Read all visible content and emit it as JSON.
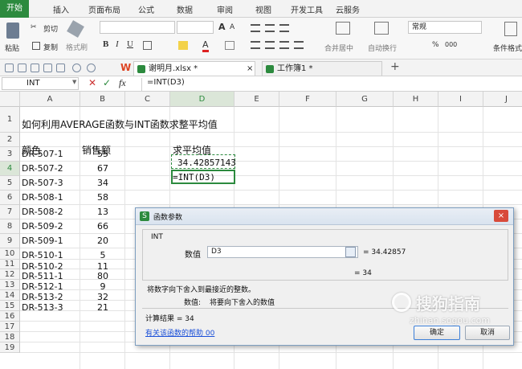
{
  "menu": {
    "items": [
      "开始",
      "插入",
      "页面布局",
      "公式",
      "数据",
      "审阅",
      "视图",
      "开发工具",
      "云服务"
    ]
  },
  "ribbon": {
    "paste": "粘贴",
    "cut": "剪切",
    "copy": "复制",
    "format_painter": "格式刷",
    "bold": "B",
    "italic": "I",
    "underline": "U",
    "font_grow": "A",
    "merge_center": "合并居中",
    "auto_wrap": "自动换行",
    "number_format": "常规",
    "percent": "%",
    "thousands": "000",
    "cond_format": "条件格式"
  },
  "tabs": [
    {
      "label": "谢明月.xlsx *"
    },
    {
      "label": "工作簿1 *"
    }
  ],
  "formula_bar": {
    "name_box": "INT",
    "fx": "fx",
    "formula": "=INT(D3)"
  },
  "columns": [
    "A",
    "B",
    "C",
    "D",
    "E",
    "F",
    "G",
    "H",
    "I",
    "J"
  ],
  "rows": [
    "1",
    "2",
    "3",
    "4",
    "5",
    "6",
    "7",
    "8",
    "9",
    "10",
    "11",
    "12",
    "13",
    "14",
    "15",
    "16",
    "17",
    "18",
    "19"
  ],
  "cells": {
    "a1": "如何利用AVERAGE函数与INT函数求整平均值",
    "a2": "颜色",
    "b2": "销售额",
    "d2": "求平均值",
    "d3": "34.42857143",
    "d4": "=INT(D3)",
    "data": [
      {
        "a": "DR-507-1",
        "b": "55"
      },
      {
        "a": "DR-507-2",
        "b": "67"
      },
      {
        "a": "DR-507-3",
        "b": "34"
      },
      {
        "a": "DR-508-1",
        "b": "58"
      },
      {
        "a": "DR-508-2",
        "b": "13"
      },
      {
        "a": "DR-509-2",
        "b": "66"
      },
      {
        "a": "DR-509-1",
        "b": "20"
      },
      {
        "a": "DR-510-1",
        "b": "5"
      },
      {
        "a": "DR-510-2",
        "b": "11"
      },
      {
        "a": "DR-511-1",
        "b": "80"
      },
      {
        "a": "DR-512-1",
        "b": "9"
      },
      {
        "a": "DR-513-2",
        "b": "32"
      },
      {
        "a": "DR-513-3",
        "b": "21"
      }
    ]
  },
  "dialog": {
    "title": "函数参数",
    "func_name": "INT",
    "arg_label": "数值",
    "arg_value": "D3",
    "arg_eval": "= 34.42857",
    "result_eval": "= 34",
    "description": "将数字向下舍入到最接近的整数。",
    "arg_desc_label": "数值:",
    "arg_desc": "将要向下舍入的数值",
    "calc_result": "计算结果 =  34",
    "help_link": "有关该函数的帮助 00",
    "ok": "确定",
    "cancel": "取消"
  },
  "watermark": {
    "text": "搜狗指南",
    "url": "zhinan.sogou.com"
  },
  "colors": {
    "accent": "#2c8a3e",
    "selection": "#2c8a3e",
    "link": "#1a4fd8"
  }
}
